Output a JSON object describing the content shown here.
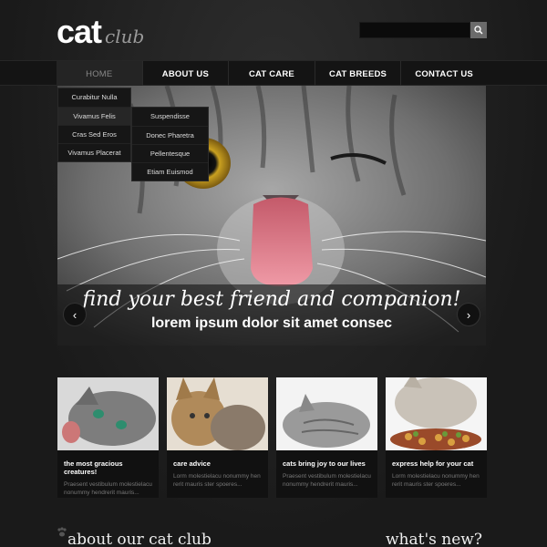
{
  "logo": {
    "main": "cat",
    "sub": "club"
  },
  "search": {
    "placeholder": ""
  },
  "nav": [
    {
      "label": "HOME",
      "active": true
    },
    {
      "label": "ABOUT US"
    },
    {
      "label": "CAT CARE"
    },
    {
      "label": "CAT BREEDS"
    },
    {
      "label": "CONTACT US"
    }
  ],
  "dropdown_main": [
    "Curabitur Nulla",
    "Vivamus  Felis",
    "Cras Sed Eros",
    "Vivamus Placerat"
  ],
  "dropdown_sub": [
    "Suspendisse",
    "Donec Pharetra",
    "Pellentesque",
    "Etiam Euismod"
  ],
  "hero": {
    "tagline": "find your best friend and companion!",
    "subtitle": "lorem ipsum dolor sit amet consec",
    "prev": "‹",
    "next": "›"
  },
  "cards": [
    {
      "title": "the most gracious creatures!",
      "text": "Praesent vestibulum molestielacu nonummy hendrerit mauris..."
    },
    {
      "title": "care advice",
      "text": "Lorm molestielacu nonummy hen rerit mauris ster spoeres..."
    },
    {
      "title": "cats bring joy to our lives",
      "text": "Praesent vestibulum molestielacu nonummy hendrerit mauris..."
    },
    {
      "title": "express help for your cat",
      "text": "Lorm molestielacu nonummy hen rerit mauris ster spoeres..."
    }
  ],
  "bottom": {
    "about": "about our cat club",
    "news": "what's new?"
  },
  "colors": {
    "background": "#1d1d1d",
    "nav": "#141414",
    "accent": "#ffffff"
  }
}
